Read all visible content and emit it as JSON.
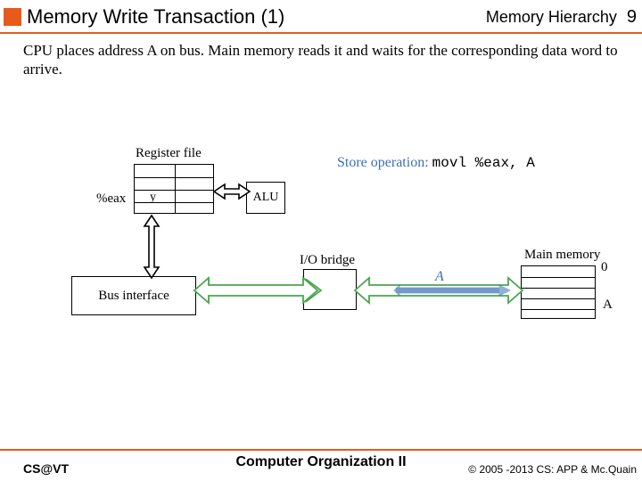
{
  "header": {
    "title": "Memory Write Transaction (1)",
    "section": "Memory Hierarchy",
    "page": "9"
  },
  "description": "CPU places address A on bus. Main memory reads it and waits for the corresponding data word to arrive.",
  "diagram": {
    "register_file_label": "Register file",
    "eax_label": "%eax",
    "reg_val": "y",
    "alu_label": "ALU",
    "io_bridge_label": "I/O bridge",
    "bus_interface_label": "Bus interface",
    "main_memory_label": "Main memory",
    "mm_index_top": "0",
    "mm_index_side": "A",
    "bus_addr_label": "A",
    "store_op_prefix": "Store operation:",
    "store_op_code": "movl %eax, A"
  },
  "footer": {
    "left": "CS@VT",
    "center": "Computer Organization II",
    "right": "© 2005 -2013 CS: APP & Mc.Quain"
  }
}
